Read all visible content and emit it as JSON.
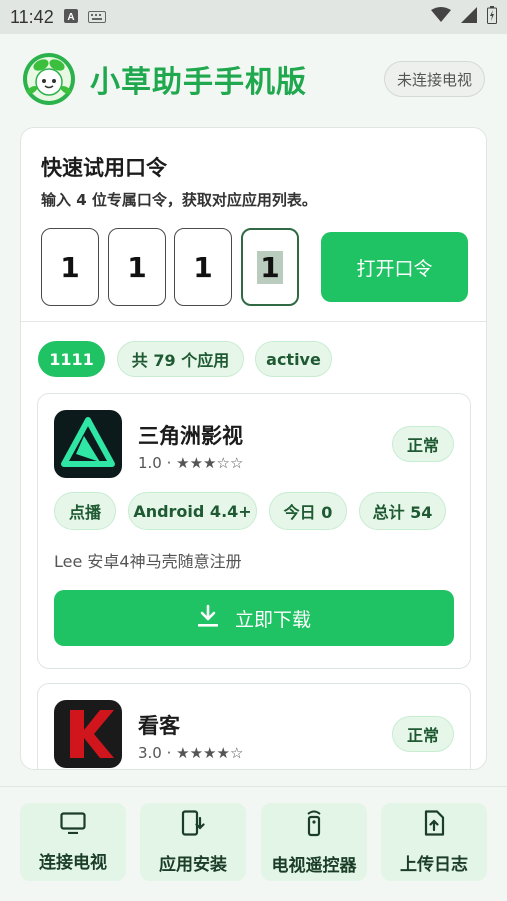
{
  "status_bar": {
    "time": "11:42"
  },
  "header": {
    "title": "小草助手手机版",
    "connection_status": "未连接电视"
  },
  "quick_trial": {
    "title": "快速试用口令",
    "description": "输入 4 位专属口令，获取对应应用列表。",
    "code": [
      "1",
      "1",
      "1",
      "1"
    ],
    "open_button": "打开口令"
  },
  "result_chips": {
    "code": "1111",
    "count": "共 79 个应用",
    "state": "active"
  },
  "apps": [
    {
      "name": "三角洲影视",
      "meta": "1.0 · ★★★☆☆",
      "status": "正常",
      "tags": [
        "点播",
        "Android 4.4+",
        "今日 0",
        "总计 54"
      ],
      "description": "Lee 安卓4神马壳随意注册",
      "download_label": "立即下载",
      "icon": "delta-triangle-icon"
    },
    {
      "name": "看客",
      "meta": "3.0 · ★★★★☆",
      "status": "正常",
      "icon": "k-letter-icon"
    }
  ],
  "bottom_nav": [
    {
      "label": "连接电视",
      "icon": "tv-icon"
    },
    {
      "label": "应用安装",
      "icon": "phone-download-icon"
    },
    {
      "label": "电视遥控器",
      "icon": "remote-icon"
    },
    {
      "label": "上传日志",
      "icon": "upload-file-icon"
    }
  ],
  "colors": {
    "accent": "#20c364",
    "title_green": "#1fa84e",
    "chip_bg": "#e6f7ea"
  }
}
